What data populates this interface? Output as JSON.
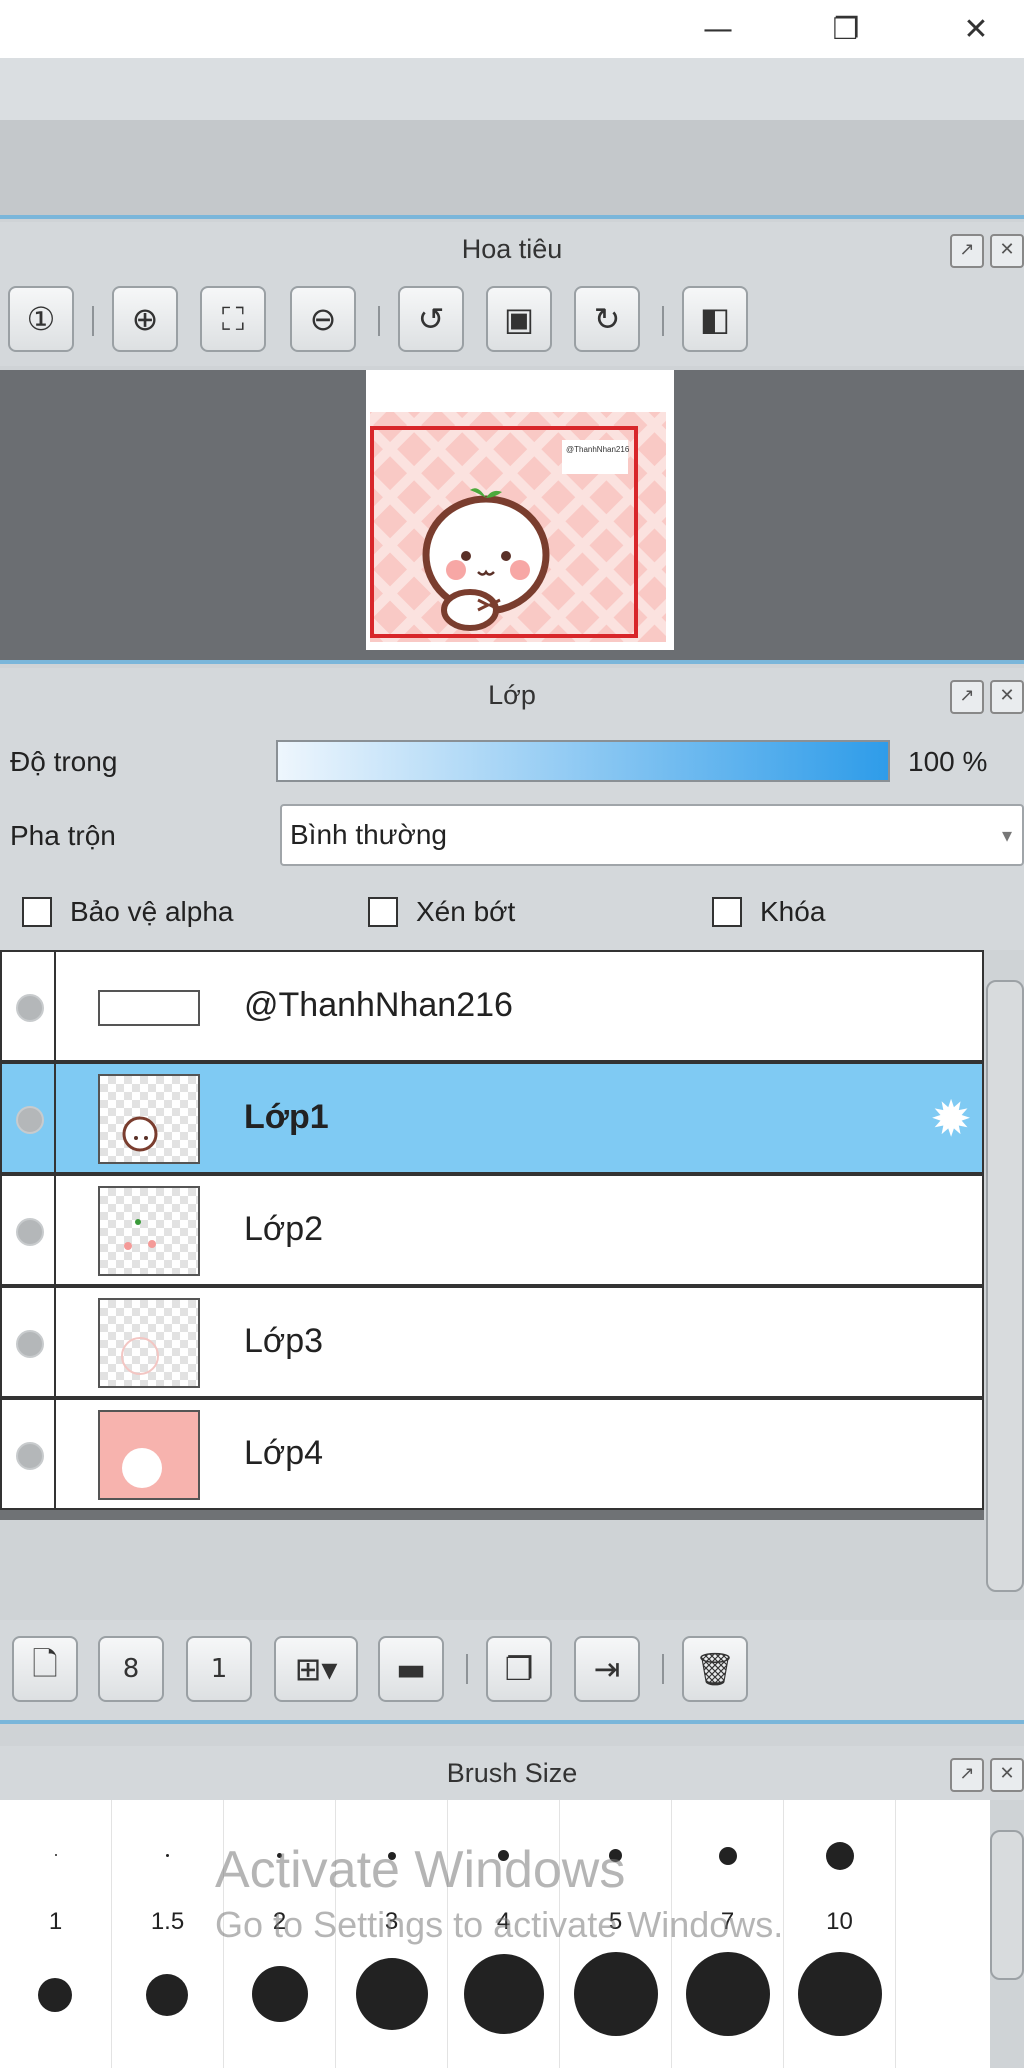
{
  "window": {
    "minimize_icon": "minimize-icon",
    "restore_icon": "restore-icon",
    "close_icon": "close-icon"
  },
  "navigator": {
    "title": "Hoa tiêu",
    "watermark_text": "@ThanhNhan216",
    "tools": [
      "zoom-actual-icon",
      "zoom-in-icon",
      "fit-window-icon",
      "zoom-out-icon",
      "rotate-left-icon",
      "reset-view-icon",
      "rotate-right-icon",
      "flip-icon"
    ]
  },
  "layers": {
    "title": "Lớp",
    "opacity_label": "Độ trong",
    "opacity_value": "100 %",
    "opacity_fraction": 1.0,
    "blend_label": "Pha trộn",
    "blend_value": "Bình thường",
    "protect_alpha_label": "Bảo vệ alpha",
    "clipping_label": "Xén bớt",
    "lock_label": "Khóa",
    "items": [
      {
        "name": "@ThanhNhan216",
        "selected": false
      },
      {
        "name": "Lớp1",
        "selected": true
      },
      {
        "name": "Lớp2",
        "selected": false
      },
      {
        "name": "Lớp3",
        "selected": false
      },
      {
        "name": "Lớp4",
        "selected": false
      }
    ],
    "bottom_tools": [
      "new-layer-icon",
      "new-8bit-layer-icon",
      "new-1bit-layer-icon",
      "add-layer-menu-icon",
      "new-folder-icon",
      "duplicate-layer-icon",
      "merge-layer-icon",
      "delete-layer-icon"
    ]
  },
  "brush_size": {
    "title": "Brush Size",
    "sizes": [
      "1",
      "1.5",
      "2",
      "3",
      "4",
      "5",
      "7",
      "10"
    ]
  },
  "watermark": {
    "line1": "Activate Windows",
    "line2": "Go to Settings to activate Windows."
  }
}
